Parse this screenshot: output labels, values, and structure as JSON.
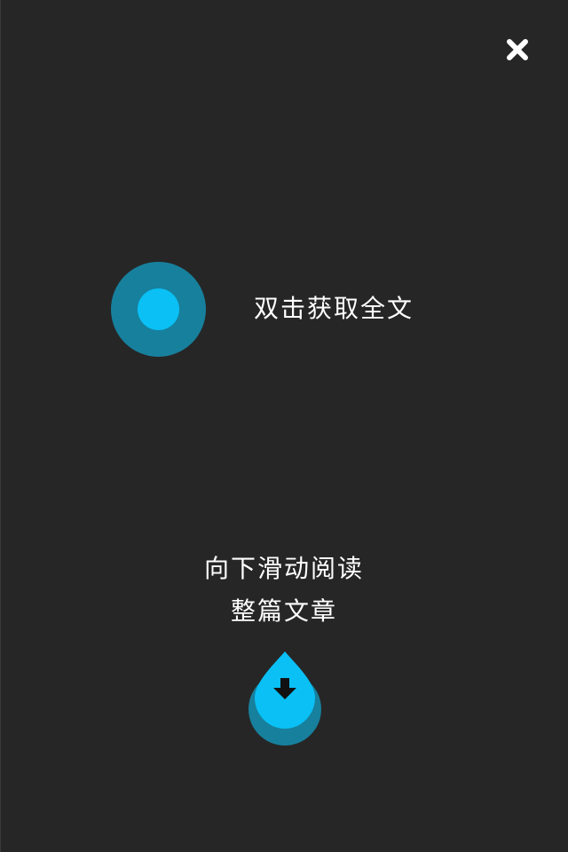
{
  "close": {
    "icon": "close-icon"
  },
  "double_tap_hint": {
    "icon": "tap-indicator-icon",
    "text": "双击获取全文"
  },
  "scroll_hint": {
    "line1": "向下滑动阅读",
    "line2": "整篇文章",
    "icon": "arrow-down-drop-icon"
  },
  "colors": {
    "background": "#262626",
    "accent": "#0ac0f5",
    "accent_dark": "#17809d",
    "text": "#ffffff"
  }
}
